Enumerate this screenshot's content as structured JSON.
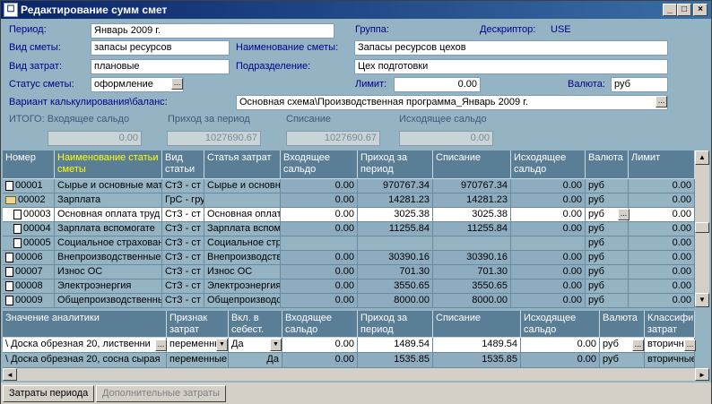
{
  "window": {
    "title": "Редактирование сумм смет"
  },
  "form": {
    "period_label": "Период:",
    "period_value": "Январь 2009 г.",
    "group_label": "Группа:",
    "descriptor_label": "Дескриптор:",
    "descriptor_value": "USE",
    "smeta_type_label": "Вид сметы:",
    "smeta_type_value": "запасы ресурсов",
    "smeta_name_label": "Наименование сметы:",
    "smeta_name_value": "Запасы ресурсов цехов",
    "cost_type_label": "Вид затрат:",
    "cost_type_value": "плановые",
    "division_label": "Подразделение:",
    "division_value": "Цех подготовки",
    "status_label": "Статус сметы:",
    "status_value": "оформление",
    "limit_label": "Лимит:",
    "limit_value": "0.00",
    "currency_label": "Валюта:",
    "currency_value": "руб",
    "variant_label": "Вариант калькулирования\\баланс:",
    "variant_value": "Основная схема\\Производственная программа_Январь 2009 г.",
    "total_label": "ИТОГО: Входящее сальдо",
    "total_in": "0.00",
    "income_label": "Приход за период",
    "income_value": "1027690.67",
    "writeoff_label": "Списание",
    "writeoff_value": "1027690.67",
    "out_label": "Исходящее сальдо",
    "out_value": "0.00"
  },
  "top_table": {
    "headers": [
      "Номер",
      "Наименование статьи сметы",
      "Вид статьи",
      "Статья затрат",
      "Входящее сальдо",
      "Приход за период",
      "Списание",
      "Исходящее сальдо",
      "Валюта",
      "Лимит"
    ],
    "rows": [
      [
        "00001",
        "Сырье и основные мат",
        "СтЗ - ст",
        "Сырье и основн",
        "0.00",
        "970767.34",
        "970767.34",
        "0.00",
        "руб",
        "0.00"
      ],
      [
        "00002",
        "Зарплата",
        "ГрС - гру",
        "",
        "0.00",
        "14281.23",
        "14281.23",
        "0.00",
        "руб",
        "0.00"
      ],
      [
        "00003",
        "Основная оплата труд",
        "СтЗ - ст",
        "Основная оплат",
        "0.00",
        "3025.38",
        "3025.38",
        "0.00",
        "руб",
        "0.00"
      ],
      [
        "00004",
        "Зарплата вспомогате",
        "СтЗ - ст",
        "Зарплата вспом",
        "0.00",
        "11255.84",
        "11255.84",
        "0.00",
        "руб",
        "0.00"
      ],
      [
        "00005",
        "Социальное страховани",
        "СтЗ - ст",
        "Социальное стр",
        "",
        "",
        "",
        "",
        "руб",
        "0.00"
      ],
      [
        "00006",
        "Внепроизводственные",
        "СтЗ - ст",
        "Внепроизводств",
        "0.00",
        "30390.16",
        "30390.16",
        "0.00",
        "руб",
        "0.00"
      ],
      [
        "00007",
        "Износ ОС",
        "СтЗ - ст",
        "Износ ОС",
        "0.00",
        "701.30",
        "701.30",
        "0.00",
        "руб",
        "0.00"
      ],
      [
        "00008",
        "Электроэнергия",
        "СтЗ - ст",
        "Электроэнергия",
        "0.00",
        "3550.65",
        "3550.65",
        "0.00",
        "руб",
        "0.00"
      ],
      [
        "00009",
        "Общепроизводственны",
        "СтЗ - ст",
        "Общепроизводс",
        "0.00",
        "8000.00",
        "8000.00",
        "0.00",
        "руб",
        "0.00"
      ]
    ]
  },
  "bottom_table": {
    "headers": [
      "Значение аналитики",
      "Признак затрат",
      "Вкл. в себест.",
      "Входящее сальдо",
      "Приход за период",
      "Списание",
      "Исходящее сальдо",
      "Валюта",
      "Классифи затрат"
    ],
    "rows": [
      [
        "\\ Доска обрезная 20, лиственни",
        "переменны",
        "Да",
        "0.00",
        "1489.54",
        "1489.54",
        "0.00",
        "руб",
        "вторичны"
      ],
      [
        "\\ Доска обрезная 20, сосна сырая",
        "переменные",
        "Да",
        "0.00",
        "1535.85",
        "1535.85",
        "0.00",
        "руб",
        "вторичные"
      ]
    ]
  },
  "tabs": [
    "Затраты периода",
    "Дополнительные затраты"
  ],
  "icons": {
    "dots": "...",
    "combo_arrow": "▼",
    "min": "_",
    "max": "□",
    "close": "×",
    "up": "▲",
    "down": "▼",
    "left": "◄",
    "right": "►"
  }
}
